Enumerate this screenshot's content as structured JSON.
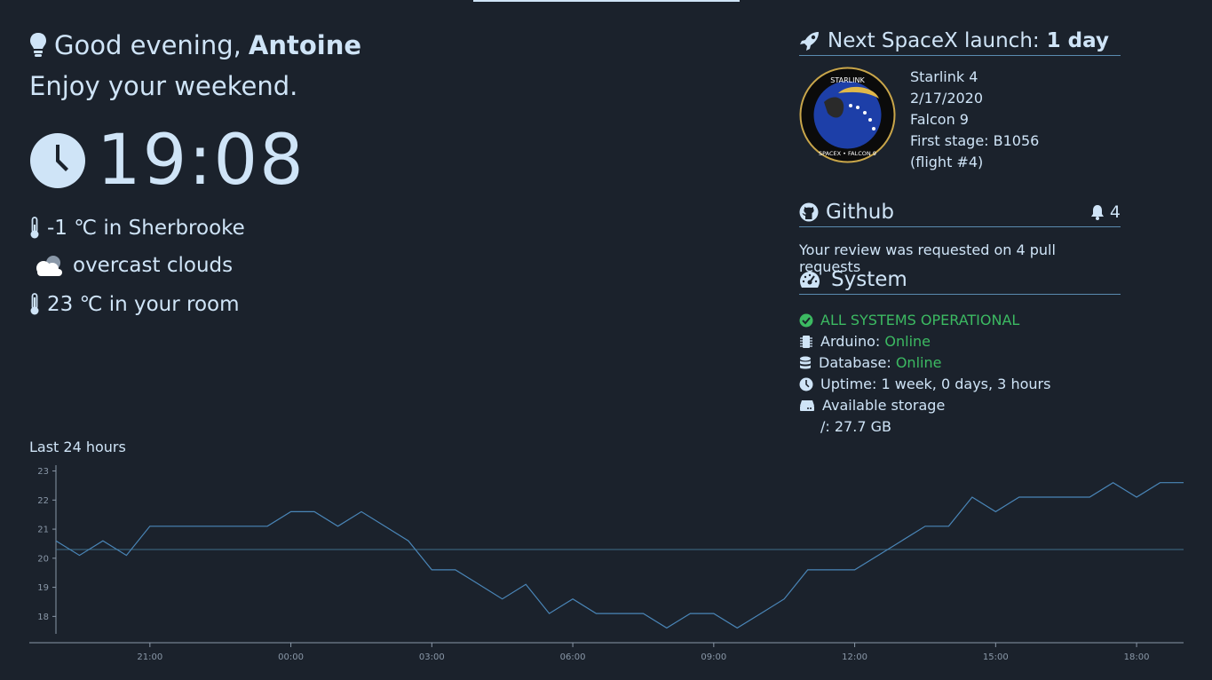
{
  "greeting": {
    "prefix": "Good evening,",
    "name": "Antoine",
    "subtitle": "Enjoy your weekend."
  },
  "clock": {
    "time": "19:08"
  },
  "weather": {
    "outdoor": "-1 ℃ in Sherbrooke",
    "condition": "overcast clouds",
    "indoor": "23 ℃ in your room"
  },
  "spacex": {
    "title_prefix": "Next SpaceX launch:",
    "title_value": "1 day",
    "patch_top": "STARLINK",
    "patch_bottom": "SPACEX • FALCON 9",
    "mission": "Starlink 4",
    "date": "2/17/2020",
    "rocket": "Falcon 9",
    "first_stage": "First stage: B1056",
    "flight": "(flight #4)"
  },
  "github": {
    "title": "Github",
    "notifications": "4",
    "message": "Your review was requested on 4 pull requests"
  },
  "system": {
    "title": "System",
    "status": "ALL SYSTEMS OPERATIONAL",
    "arduino_label": "Arduino:",
    "arduino_value": "Online",
    "database_label": "Database:",
    "database_value": "Online",
    "uptime": "Uptime: 1 week, 0 days, 3 hours",
    "storage_label": "Available storage",
    "storage_value": "/: 27.7 GB"
  },
  "colors": {
    "background": "#1b222c",
    "text": "#cfe4f7",
    "ok": "#3cba62",
    "line": "#5a8bb0"
  },
  "chart_data": {
    "type": "line",
    "title": "Last 24 hours",
    "x": [
      "19:00",
      "19:30",
      "20:00",
      "20:30",
      "21:00",
      "21:30",
      "22:00",
      "22:30",
      "23:00",
      "23:30",
      "00:00",
      "00:30",
      "01:00",
      "01:30",
      "02:00",
      "02:30",
      "03:00",
      "03:30",
      "04:00",
      "04:30",
      "05:00",
      "05:30",
      "06:00",
      "06:30",
      "07:00",
      "07:30",
      "08:00",
      "08:30",
      "09:00",
      "09:30",
      "10:00",
      "10:30",
      "11:00",
      "11:30",
      "12:00",
      "12:30",
      "13:00",
      "13:30",
      "14:00",
      "14:30",
      "15:00",
      "15:30",
      "16:00",
      "16:30",
      "17:00",
      "17:30",
      "18:00",
      "18:30",
      "19:00"
    ],
    "values": [
      20.6,
      20.1,
      20.6,
      20.1,
      21.1,
      21.1,
      21.1,
      21.1,
      21.1,
      21.1,
      21.6,
      21.6,
      21.1,
      21.6,
      21.1,
      20.6,
      19.6,
      19.6,
      19.1,
      18.6,
      19.1,
      18.1,
      18.6,
      18.1,
      18.1,
      18.1,
      17.6,
      18.1,
      18.1,
      17.6,
      18.1,
      18.6,
      19.6,
      19.6,
      19.6,
      20.1,
      20.6,
      21.1,
      21.1,
      22.1,
      21.6,
      22.1,
      22.1,
      22.1,
      22.1,
      22.6,
      22.1,
      22.6,
      22.6
    ],
    "reference_line": 20.3,
    "y_ticks": [
      18,
      19,
      20,
      21,
      22,
      23
    ],
    "x_ticks": [
      "21:00",
      "00:00",
      "03:00",
      "06:00",
      "09:00",
      "12:00",
      "15:00",
      "18:00"
    ],
    "ylim": [
      17.4,
      23.2
    ]
  }
}
